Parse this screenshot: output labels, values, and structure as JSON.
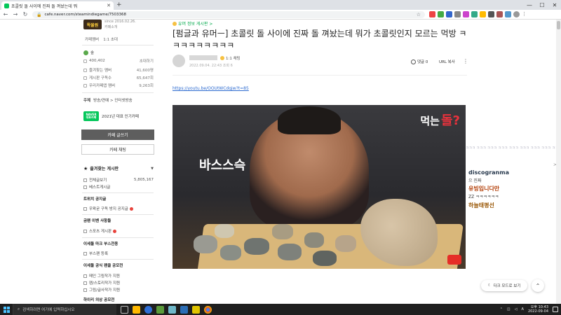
{
  "browser": {
    "tab_title": "초콜릿 돌 사이에 진짜 돌 껴놨는데 뭐",
    "url": "cafe.naver.com/steamindiegame/7503368",
    "win_min": "—",
    "win_max": "☐",
    "win_close": "✕"
  },
  "sidebar": {
    "logo_text": "왁물원",
    "since": "since 2016.02.26.",
    "intro": "카페소개",
    "links": [
      "카페멤버",
      "1:1 초대"
    ],
    "manager_label": "숲",
    "manager_invite": "초대하기",
    "stats": [
      {
        "label": "400,402",
        "value": "초대하기"
      },
      {
        "label": "즐겨찾는 멤버",
        "value": "41,600명"
      },
      {
        "label": "게시판 구독수",
        "value": "65,647회"
      },
      {
        "label": "우리카페앱 멤버",
        "value": "9,263회"
      }
    ],
    "topic_label": "주제",
    "topic_value": "방송/연예 > 인터넷방송",
    "award_badge_top": "NAVER",
    "award_badge_bottom": "대표카페",
    "award_text": "2021년 대표 인기카페",
    "write_button": "카페 글쓰기",
    "chat_button": "카페 채팅",
    "fav_boards_title": "즐겨찾는 게시판",
    "boards": [
      {
        "label": "전체글보기",
        "value": "5,805,167"
      },
      {
        "label": "베스트게시글",
        "value": ""
      }
    ],
    "sections": [
      {
        "title": "트위치 공지글",
        "items": [
          "우왁굳 구독 방지 공지글"
        ]
      },
      {
        "title": "금팬 이벤 사항들",
        "items": [
          "스포츠 게시판"
        ]
      },
      {
        "title": "이세돌 마크 부스전용",
        "items": [
          "부스팬 등록"
        ]
      },
      {
        "title": "이세돌 공식 팬클 공모전",
        "items": [
          "메인 그림작가 지원",
          "팬/스토리작가 지원",
          "그림/글사작가 지원"
        ]
      },
      {
        "title": "하이리 의상 공모전",
        "items": []
      }
    ]
  },
  "article": {
    "breadcrumb": "유머 정보 게시판 >",
    "title": "[펌글과 유머ㅡ] 초콜릿 돌 사이에 진짜 돌 껴놨는데 뭐가 초콜릿인지 모르는 먹방 ㅋㅋㅋㅋㅋㅋㅋㅋㅋ",
    "author_grade": "1:1 채팅",
    "meta": "2022.09.04. 22:43 조회 6",
    "comments_label": "댓글 0",
    "url_copy": "URL 복사",
    "kebab": "⋮",
    "youtube_link": "https://youtu.be/OOUtWCdgjw?t=85",
    "video_caption_top_white": "먹는",
    "video_caption_top_red": "돌?",
    "video_caption_mid": "바스스슥"
  },
  "chat": {
    "top_rule": "ㅋㅋㅋ ㅋㅋㅋ ㅋㅋㅋ ㅋㅋㅋ ㅋㅋㅋ ㅋㅋㅋ ㅋㅋㅋ ㅋㅋㅋ ㅋㅋ",
    "lines": [
      {
        "user": "discogranma",
        "text": "으 진짜"
      },
      {
        "user": "유빙입니다만",
        "text": "ZZ ㅋㅋㅋㅋㅋㅋ"
      },
      {
        "user": "하늘태평선",
        "text": ""
      }
    ],
    "colors": [
      "#2a3b4f",
      "#b4420c",
      "#9b5a0a"
    ]
  },
  "float": {
    "dark_mode": "다크 모드로 보기",
    "scroll_top": "⌃"
  },
  "taskbar": {
    "search_placeholder": "검색하려면 여기에 입력하십시오",
    "clock_time": "오후 10:43",
    "clock_date": "2022-09-04"
  }
}
